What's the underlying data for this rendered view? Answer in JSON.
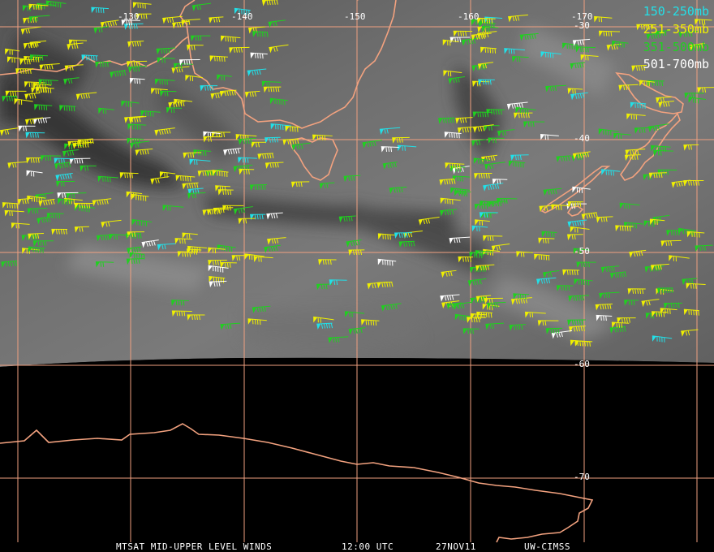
{
  "map": {
    "grid_color": "#f0a080",
    "coast_color": "#f3a27f",
    "image_bg_color": "#6a6a6a",
    "space_color": "#000000",
    "longitude_labels": [
      {
        "text": "-130",
        "deg": -130
      },
      {
        "text": "-140",
        "deg": -140
      },
      {
        "text": "-150",
        "deg": -150
      },
      {
        "text": "-160",
        "deg": -160
      },
      {
        "text": "-170",
        "deg": -170
      }
    ],
    "latitude_labels": [
      {
        "text": "-30",
        "deg": -30
      },
      {
        "text": "-40",
        "deg": -40
      },
      {
        "text": "-50",
        "deg": -50
      },
      {
        "text": "-60",
        "deg": -60
      },
      {
        "text": "-70",
        "deg": -70
      }
    ]
  },
  "legend": [
    {
      "label": "150-250mb",
      "color": "#22e0e8"
    },
    {
      "label": "251-350mb",
      "color": "#f0f000"
    },
    {
      "label": "351-500mb",
      "color": "#20d020"
    },
    {
      "label": "501-700mb",
      "color": "#ffffff"
    }
  ],
  "footer": {
    "product": "MTSAT MID-UPPER LEVEL WINDS",
    "time": "12:00 UTC",
    "date": "27NOV11",
    "source": "UW-CIMSS"
  }
}
